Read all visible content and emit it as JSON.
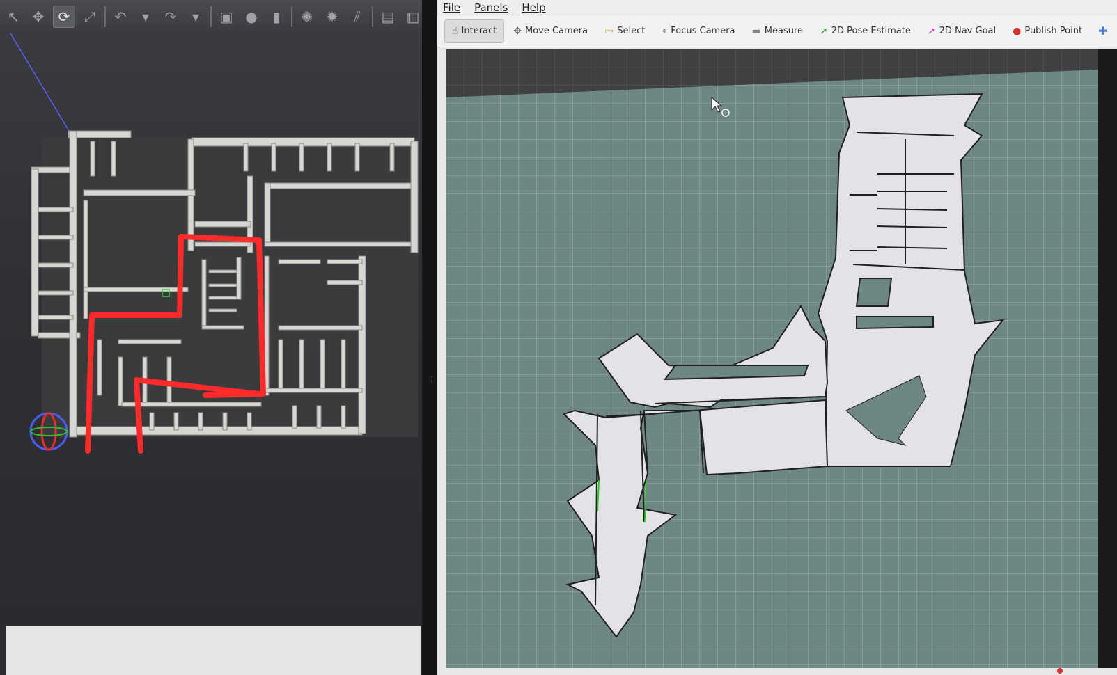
{
  "gazebo": {
    "toolbar_icons": [
      {
        "name": "select-arrow-icon",
        "glyph": "↖"
      },
      {
        "name": "translate-icon",
        "glyph": "✥"
      },
      {
        "name": "rotate-icon",
        "glyph": "⟳",
        "active": true
      },
      {
        "name": "scale-icon",
        "glyph": "⤢"
      },
      {
        "name": "undo-icon",
        "glyph": "↶"
      },
      {
        "name": "undo-dropdown-icon",
        "glyph": "▾"
      },
      {
        "name": "redo-icon",
        "glyph": "↷"
      },
      {
        "name": "redo-dropdown-icon",
        "glyph": "▾"
      },
      {
        "name": "box-shape-icon",
        "glyph": "▣"
      },
      {
        "name": "sphere-shape-icon",
        "glyph": "●"
      },
      {
        "name": "cylinder-shape-icon",
        "glyph": "▮"
      },
      {
        "name": "point-light-icon",
        "glyph": "✺"
      },
      {
        "name": "spot-light-icon",
        "glyph": "✹"
      },
      {
        "name": "directional-light-icon",
        "glyph": "⫽"
      },
      {
        "name": "copy-icon",
        "glyph": "▤"
      },
      {
        "name": "paste-icon",
        "glyph": "▥"
      }
    ],
    "annotation_color": "#ff2a2a"
  },
  "rviz": {
    "menu": [
      "File",
      "Panels",
      "Help"
    ],
    "tools": [
      {
        "label": "Interact",
        "icon": "hand-icon",
        "glyph": "☝",
        "color": "#555",
        "active": true
      },
      {
        "label": "Move Camera",
        "icon": "move-camera-icon",
        "glyph": "✥",
        "color": "#666"
      },
      {
        "label": "Select",
        "icon": "select-icon",
        "glyph": "▭",
        "color": "#c9b33a"
      },
      {
        "label": "Focus Camera",
        "icon": "focus-camera-icon",
        "glyph": "⌖",
        "color": "#666"
      },
      {
        "label": "Measure",
        "icon": "measure-icon",
        "glyph": "▬",
        "color": "#888"
      },
      {
        "label": "2D Pose Estimate",
        "icon": "pose-estimate-icon",
        "glyph": "➚",
        "color": "#2fae3a"
      },
      {
        "label": "2D Nav Goal",
        "icon": "nav-goal-icon",
        "glyph": "➚",
        "color": "#d43ad4"
      },
      {
        "label": "Publish Point",
        "icon": "publish-point-icon",
        "glyph": "●",
        "color": "#d6332c"
      }
    ],
    "map_colors": {
      "free": "#e4e2e6",
      "unknown": "#6f8783",
      "grid": "#9fb0ad",
      "wall": "#202020"
    }
  }
}
